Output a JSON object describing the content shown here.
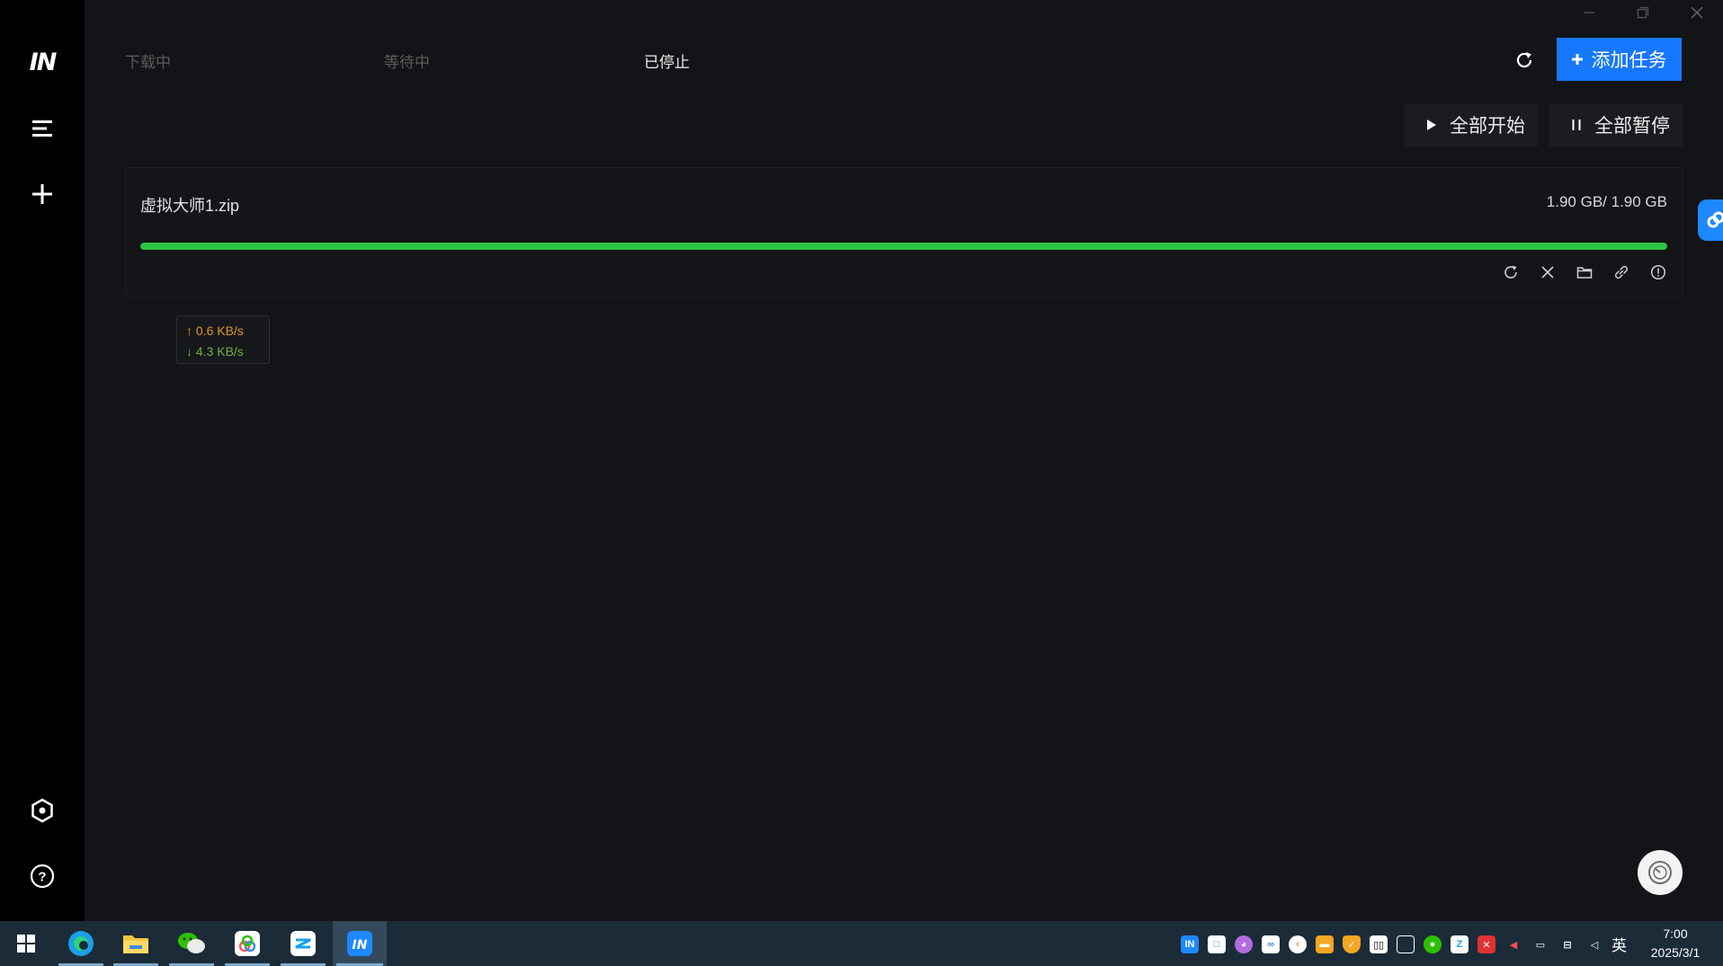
{
  "app": {
    "logo_text": "IN",
    "title": ""
  },
  "sidebar": {
    "items": [
      {
        "name": "menu-icon"
      },
      {
        "name": "add-icon"
      },
      {
        "name": "settings-icon"
      },
      {
        "name": "help-icon"
      }
    ]
  },
  "tabs": [
    {
      "label": "下载中",
      "active": false
    },
    {
      "label": "等待中",
      "active": false
    },
    {
      "label": "已停止",
      "active": true
    }
  ],
  "toolbar": {
    "add_task_label": "添加任务",
    "start_all_label": "全部开始",
    "pause_all_label": "全部暂停"
  },
  "task": {
    "name": "虚拟大师1.zip",
    "size": "1.90 GB/ 1.90 GB",
    "progress": 1.0,
    "actions": [
      "refresh-icon",
      "close-icon",
      "folder-icon",
      "link-icon",
      "info-icon"
    ]
  },
  "speed": {
    "upload": "↑ 0.6 KB/s",
    "download": "↓ 4.3 KB/s"
  },
  "taskbar": {
    "ime": "英",
    "time": "7:00",
    "date": "2025/3/1"
  },
  "colors": {
    "accent": "#1677ff",
    "progress": "#2ec443",
    "upload": "#e0962a",
    "download": "#69b542"
  }
}
